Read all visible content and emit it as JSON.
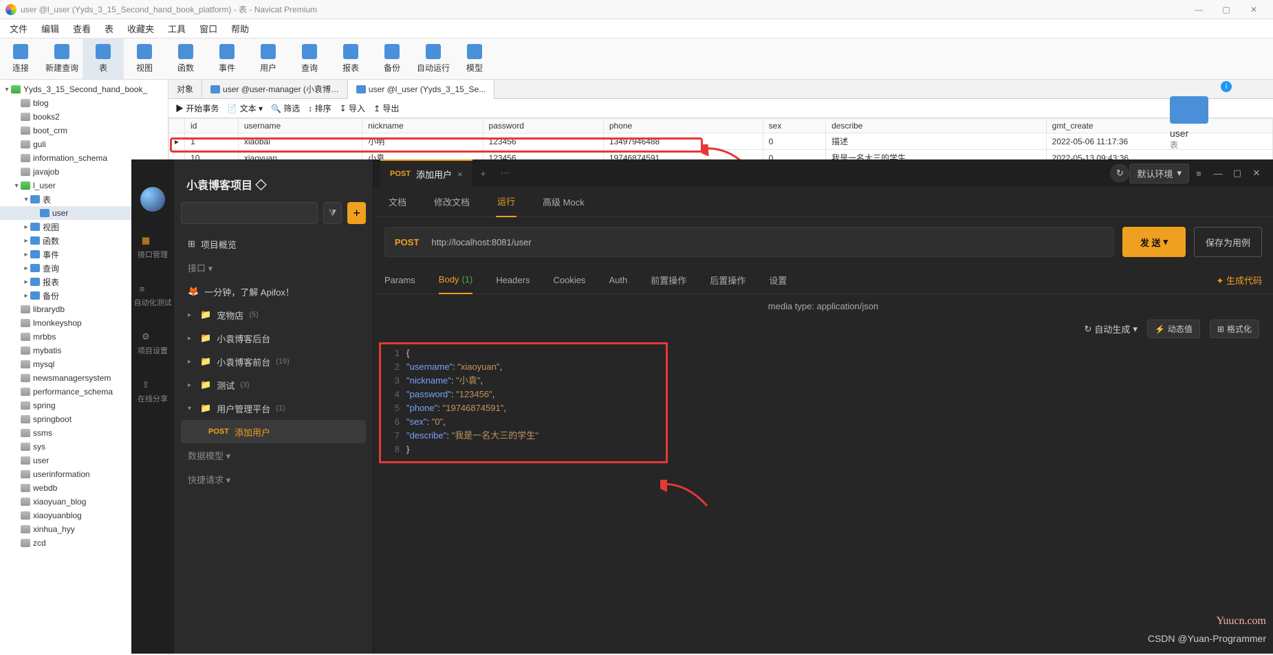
{
  "title": "user @l_user (Yyds_3_15_Second_hand_book_platform) - 表 - Navicat Premium",
  "menu": [
    "文件",
    "编辑",
    "查看",
    "表",
    "收藏夹",
    "工具",
    "窗口",
    "帮助"
  ],
  "toolbar": [
    {
      "label": "连接",
      "icon": "plug"
    },
    {
      "label": "新建查询",
      "icon": "docplus"
    },
    {
      "label": "表",
      "icon": "grid",
      "active": true
    },
    {
      "label": "视图",
      "icon": "eye"
    },
    {
      "label": "函数",
      "icon": "fx"
    },
    {
      "label": "事件",
      "icon": "clock"
    },
    {
      "label": "用户",
      "icon": "user"
    },
    {
      "label": "查询",
      "icon": "zoom"
    },
    {
      "label": "报表",
      "icon": "report"
    },
    {
      "label": "备份",
      "icon": "backup"
    },
    {
      "label": "自动运行",
      "icon": "auto"
    },
    {
      "label": "模型",
      "icon": "model"
    }
  ],
  "tree": [
    {
      "indent": 0,
      "caret": "v",
      "icon": "db-green",
      "label": "Yyds_3_15_Second_hand_book_"
    },
    {
      "indent": 1,
      "icon": "db",
      "label": "blog"
    },
    {
      "indent": 1,
      "icon": "db",
      "label": "books2"
    },
    {
      "indent": 1,
      "icon": "db",
      "label": "boot_crm"
    },
    {
      "indent": 1,
      "icon": "db",
      "label": "guli"
    },
    {
      "indent": 1,
      "icon": "db",
      "label": "information_schema"
    },
    {
      "indent": 1,
      "icon": "db",
      "label": "javajob"
    },
    {
      "indent": 1,
      "caret": "v",
      "icon": "db-green",
      "label": "l_user"
    },
    {
      "indent": 2,
      "caret": "v",
      "icon": "tbl",
      "label": "表"
    },
    {
      "indent": 3,
      "icon": "tbl",
      "label": "user",
      "selected": true
    },
    {
      "indent": 2,
      "caret": ">",
      "icon": "tbl",
      "label": "视图"
    },
    {
      "indent": 2,
      "caret": ">",
      "icon": "tbl",
      "label": "函数"
    },
    {
      "indent": 2,
      "caret": ">",
      "icon": "tbl",
      "label": "事件"
    },
    {
      "indent": 2,
      "caret": ">",
      "icon": "tbl",
      "label": "查询"
    },
    {
      "indent": 2,
      "caret": ">",
      "icon": "tbl",
      "label": "报表"
    },
    {
      "indent": 2,
      "caret": ">",
      "icon": "tbl",
      "label": "备份"
    },
    {
      "indent": 1,
      "icon": "db",
      "label": "librarydb"
    },
    {
      "indent": 1,
      "icon": "db",
      "label": "lmonkeyshop"
    },
    {
      "indent": 1,
      "icon": "db",
      "label": "mrbbs"
    },
    {
      "indent": 1,
      "icon": "db",
      "label": "mybatis"
    },
    {
      "indent": 1,
      "icon": "db",
      "label": "mysql"
    },
    {
      "indent": 1,
      "icon": "db",
      "label": "newsmanagersystem"
    },
    {
      "indent": 1,
      "icon": "db",
      "label": "performance_schema"
    },
    {
      "indent": 1,
      "icon": "db",
      "label": "spring"
    },
    {
      "indent": 1,
      "icon": "db",
      "label": "springboot"
    },
    {
      "indent": 1,
      "icon": "db",
      "label": "ssms"
    },
    {
      "indent": 1,
      "icon": "db",
      "label": "sys"
    },
    {
      "indent": 1,
      "icon": "db",
      "label": "user"
    },
    {
      "indent": 1,
      "icon": "db",
      "label": "userinformation"
    },
    {
      "indent": 1,
      "icon": "db",
      "label": "webdb"
    },
    {
      "indent": 1,
      "icon": "db",
      "label": "xiaoyuan_blog"
    },
    {
      "indent": 1,
      "icon": "db",
      "label": "xiaoyuanblog"
    },
    {
      "indent": 1,
      "icon": "db",
      "label": "xinhua_hyy"
    },
    {
      "indent": 1,
      "icon": "db",
      "label": "zcd"
    }
  ],
  "tabs": [
    {
      "label": "对象",
      "active": false
    },
    {
      "label": "user @user-manager (小袁博…",
      "active": false,
      "icon": true
    },
    {
      "label": "user @l_user (Yyds_3_15_Se...",
      "active": true,
      "icon": true
    }
  ],
  "subToolbar": [
    "开始事务",
    "文本 ▾",
    "筛选",
    "排序",
    "导入",
    "导出"
  ],
  "table": {
    "headers": [
      "id",
      "username",
      "nickname",
      "password",
      "phone",
      "sex",
      "describe",
      "gmt_create"
    ],
    "rows": [
      [
        "1",
        "xiaobai",
        "小明",
        "123456",
        "13497946488",
        "0",
        "描述",
        "2022-05-06 11:17:36"
      ],
      [
        "10",
        "xiaoyuan",
        "小袁",
        "123456",
        "19746874591",
        "0",
        "我是一名大三的学生",
        "2022-05-13 09:43:36"
      ]
    ]
  },
  "userPanel": {
    "title": "user",
    "sub": "表"
  },
  "apifox": {
    "rail": [
      {
        "name": "avatar"
      },
      {
        "name": "home",
        "label": "接口管理",
        "active": true
      },
      {
        "name": "auto",
        "label": "自动化测试"
      },
      {
        "name": "settings",
        "label": "项目设置"
      },
      {
        "name": "share",
        "label": "在线分享"
      }
    ],
    "project": "小袁博客项目 ◇",
    "searchPlaceholder": "",
    "overview": "项目概览",
    "apiLabel": "接口 ▾",
    "apiHint": "一分钟，了解 Apifox！",
    "folders": [
      {
        "name": "宠物店",
        "count": "(5)"
      },
      {
        "name": "小袁博客后台"
      },
      {
        "name": "小袁博客前台",
        "count": "(19)"
      },
      {
        "name": "测试",
        "count": "(3)"
      },
      {
        "name": "用户管理平台",
        "count": "(1)",
        "open": true
      }
    ],
    "selectedRequest": {
      "method": "POST",
      "name": "添加用户"
    },
    "bottom": [
      "数据模型 ▾",
      "快捷请求 ▾"
    ],
    "openTab": {
      "method": "POST",
      "name": "添加用户"
    },
    "env": "默认环境",
    "docTabs": [
      "文档",
      "修改文档",
      "运行",
      "高级 Mock"
    ],
    "activeDocTab": "运行",
    "method": "POST",
    "url": "http://localhost:8081/user",
    "sendBtn": "发 送",
    "saveBtn": "保存为用例",
    "reqTabs": [
      "Params",
      "Body",
      "Headers",
      "Cookies",
      "Auth",
      "前置操作",
      "后置操作",
      "设置"
    ],
    "activeReqTab": "Body",
    "bodyCount": "(1)",
    "genCode": "生成代码",
    "mediaType": "media type: application/json",
    "autoGen": "自动生成",
    "dynVal": "动态值",
    "format": "格式化",
    "editor_lines": [
      "{",
      "    \"username\": \"xiaoyuan\",",
      "    \"nickname\": \"小袁\",",
      "    \"password\": \"123456\",",
      "    \"phone\": \"19746874591\",",
      "    \"sex\": \"0\",",
      "    \"describe\": \"我是一名大三的学生\"",
      "}"
    ]
  },
  "watermark": {
    "a": "Yuucn.com",
    "b": "CSDN @Yuan-Programmer"
  }
}
